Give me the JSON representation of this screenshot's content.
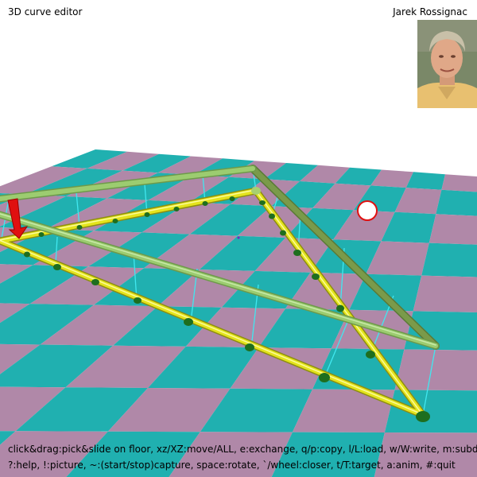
{
  "app": {
    "title": "3D curve editor"
  },
  "author": {
    "name": "Jarek Rossignac"
  },
  "help": {
    "line1": "click&drag:pick&slide on floor, xz/XZ:move/ALL, e:exchange, q/p:copy, l/L:load, w/W:write, m:subdivide",
    "line2": "?:help, !:picture, ~:(start/stop)capture, space:rotate, `/wheel:closer, t/T:target, a:anim, #:quit"
  },
  "colors": {
    "floor_teal": "#20b0b0",
    "floor_mauve": "#b088a8",
    "yellow_tube": "#e4e41c",
    "green_tube": "#9ccc70",
    "dark_green_tube": "#7a9a4a",
    "node_green": "#1e6e1e",
    "drop_lines": "#40e8f0",
    "arrow_red": "#e01010"
  },
  "icons": {
    "target": "target-circle-icon",
    "arrow": "red-arrow-icon"
  }
}
